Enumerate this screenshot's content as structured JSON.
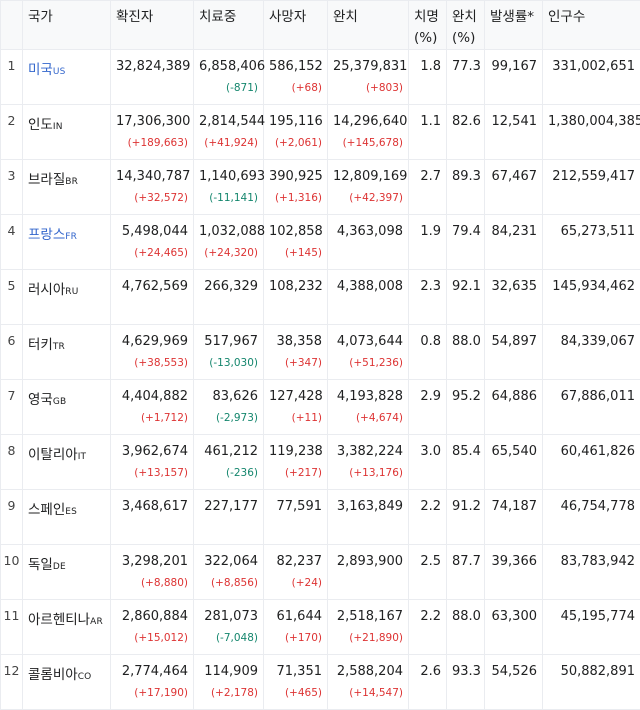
{
  "headers": {
    "country": "국가",
    "confirmed": "확진자",
    "treating": "치료중",
    "deaths": "사망자",
    "recovered": "완치",
    "fatality": "치명\n(%)",
    "recovery": "완치\n(%)",
    "incidence": "발생률*",
    "population": "인구수"
  },
  "rows": [
    {
      "rank": "1",
      "name": "미국",
      "code": "US",
      "link": true,
      "confirmed": "32,824,389",
      "confirmed_delta": "",
      "treating": "6,858,406",
      "treating_delta": "(-871)",
      "deaths": "586,152",
      "deaths_delta": "(+68)",
      "recovered": "25,379,831",
      "recovered_delta": "(+803)",
      "fatality": "1.8",
      "recovery": "77.3",
      "incidence": "99,167",
      "population": "331,002,651"
    },
    {
      "rank": "2",
      "name": "인도",
      "code": "IN",
      "link": false,
      "confirmed": "17,306,300",
      "confirmed_delta": "(+189,663)",
      "treating": "2,814,544",
      "treating_delta": "(+41,924)",
      "deaths": "195,116",
      "deaths_delta": "(+2,061)",
      "recovered": "14,296,640",
      "recovered_delta": "(+145,678)",
      "fatality": "1.1",
      "recovery": "82.6",
      "incidence": "12,541",
      "population": "1,380,004,385"
    },
    {
      "rank": "3",
      "name": "브라질",
      "code": "BR",
      "link": false,
      "confirmed": "14,340,787",
      "confirmed_delta": "(+32,572)",
      "treating": "1,140,693",
      "treating_delta": "(-11,141)",
      "deaths": "390,925",
      "deaths_delta": "(+1,316)",
      "recovered": "12,809,169",
      "recovered_delta": "(+42,397)",
      "fatality": "2.7",
      "recovery": "89.3",
      "incidence": "67,467",
      "population": "212,559,417"
    },
    {
      "rank": "4",
      "name": "프랑스",
      "code": "FR",
      "link": true,
      "confirmed": "5,498,044",
      "confirmed_delta": "(+24,465)",
      "treating": "1,032,088",
      "treating_delta": "(+24,320)",
      "deaths": "102,858",
      "deaths_delta": "(+145)",
      "recovered": "4,363,098",
      "recovered_delta": "",
      "fatality": "1.9",
      "recovery": "79.4",
      "incidence": "84,231",
      "population": "65,273,511"
    },
    {
      "rank": "5",
      "name": "러시아",
      "code": "RU",
      "link": false,
      "confirmed": "4,762,569",
      "confirmed_delta": "",
      "treating": "266,329",
      "treating_delta": "",
      "deaths": "108,232",
      "deaths_delta": "",
      "recovered": "4,388,008",
      "recovered_delta": "",
      "fatality": "2.3",
      "recovery": "92.1",
      "incidence": "32,635",
      "population": "145,934,462"
    },
    {
      "rank": "6",
      "name": "터키",
      "code": "TR",
      "link": false,
      "confirmed": "4,629,969",
      "confirmed_delta": "(+38,553)",
      "treating": "517,967",
      "treating_delta": "(-13,030)",
      "deaths": "38,358",
      "deaths_delta": "(+347)",
      "recovered": "4,073,644",
      "recovered_delta": "(+51,236)",
      "fatality": "0.8",
      "recovery": "88.0",
      "incidence": "54,897",
      "population": "84,339,067"
    },
    {
      "rank": "7",
      "name": "영국",
      "code": "GB",
      "link": false,
      "confirmed": "4,404,882",
      "confirmed_delta": "(+1,712)",
      "treating": "83,626",
      "treating_delta": "(-2,973)",
      "deaths": "127,428",
      "deaths_delta": "(+11)",
      "recovered": "4,193,828",
      "recovered_delta": "(+4,674)",
      "fatality": "2.9",
      "recovery": "95.2",
      "incidence": "64,886",
      "population": "67,886,011"
    },
    {
      "rank": "8",
      "name": "이탈리아",
      "code": "IT",
      "link": false,
      "confirmed": "3,962,674",
      "confirmed_delta": "(+13,157)",
      "treating": "461,212",
      "treating_delta": "(-236)",
      "deaths": "119,238",
      "deaths_delta": "(+217)",
      "recovered": "3,382,224",
      "recovered_delta": "(+13,176)",
      "fatality": "3.0",
      "recovery": "85.4",
      "incidence": "65,540",
      "population": "60,461,826"
    },
    {
      "rank": "9",
      "name": "스페인",
      "code": "ES",
      "link": false,
      "confirmed": "3,468,617",
      "confirmed_delta": "",
      "treating": "227,177",
      "treating_delta": "",
      "deaths": "77,591",
      "deaths_delta": "",
      "recovered": "3,163,849",
      "recovered_delta": "",
      "fatality": "2.2",
      "recovery": "91.2",
      "incidence": "74,187",
      "population": "46,754,778"
    },
    {
      "rank": "10",
      "name": "독일",
      "code": "DE",
      "link": false,
      "confirmed": "3,298,201",
      "confirmed_delta": "(+8,880)",
      "treating": "322,064",
      "treating_delta": "(+8,856)",
      "deaths": "82,237",
      "deaths_delta": "(+24)",
      "recovered": "2,893,900",
      "recovered_delta": "",
      "fatality": "2.5",
      "recovery": "87.7",
      "incidence": "39,366",
      "population": "83,783,942"
    },
    {
      "rank": "11",
      "name": "아르헨티나",
      "code": "AR",
      "link": false,
      "confirmed": "2,860,884",
      "confirmed_delta": "(+15,012)",
      "treating": "281,073",
      "treating_delta": "(-7,048)",
      "deaths": "61,644",
      "deaths_delta": "(+170)",
      "recovered": "2,518,167",
      "recovered_delta": "(+21,890)",
      "fatality": "2.2",
      "recovery": "88.0",
      "incidence": "63,300",
      "population": "45,195,774"
    },
    {
      "rank": "12",
      "name": "콜롬비아",
      "code": "CO",
      "link": false,
      "confirmed": "2,774,464",
      "confirmed_delta": "(+17,190)",
      "treating": "114,909",
      "treating_delta": "(+2,178)",
      "deaths": "71,351",
      "deaths_delta": "(+465)",
      "recovered": "2,588,204",
      "recovered_delta": "(+14,547)",
      "fatality": "2.6",
      "recovery": "93.3",
      "incidence": "54,526",
      "population": "50,882,891"
    }
  ],
  "colors": {
    "increase": "#dd3333",
    "decrease": "#14866d",
    "link": "#3366cc",
    "header_bg": "#f8f9fa",
    "border": "#eaecf0"
  }
}
